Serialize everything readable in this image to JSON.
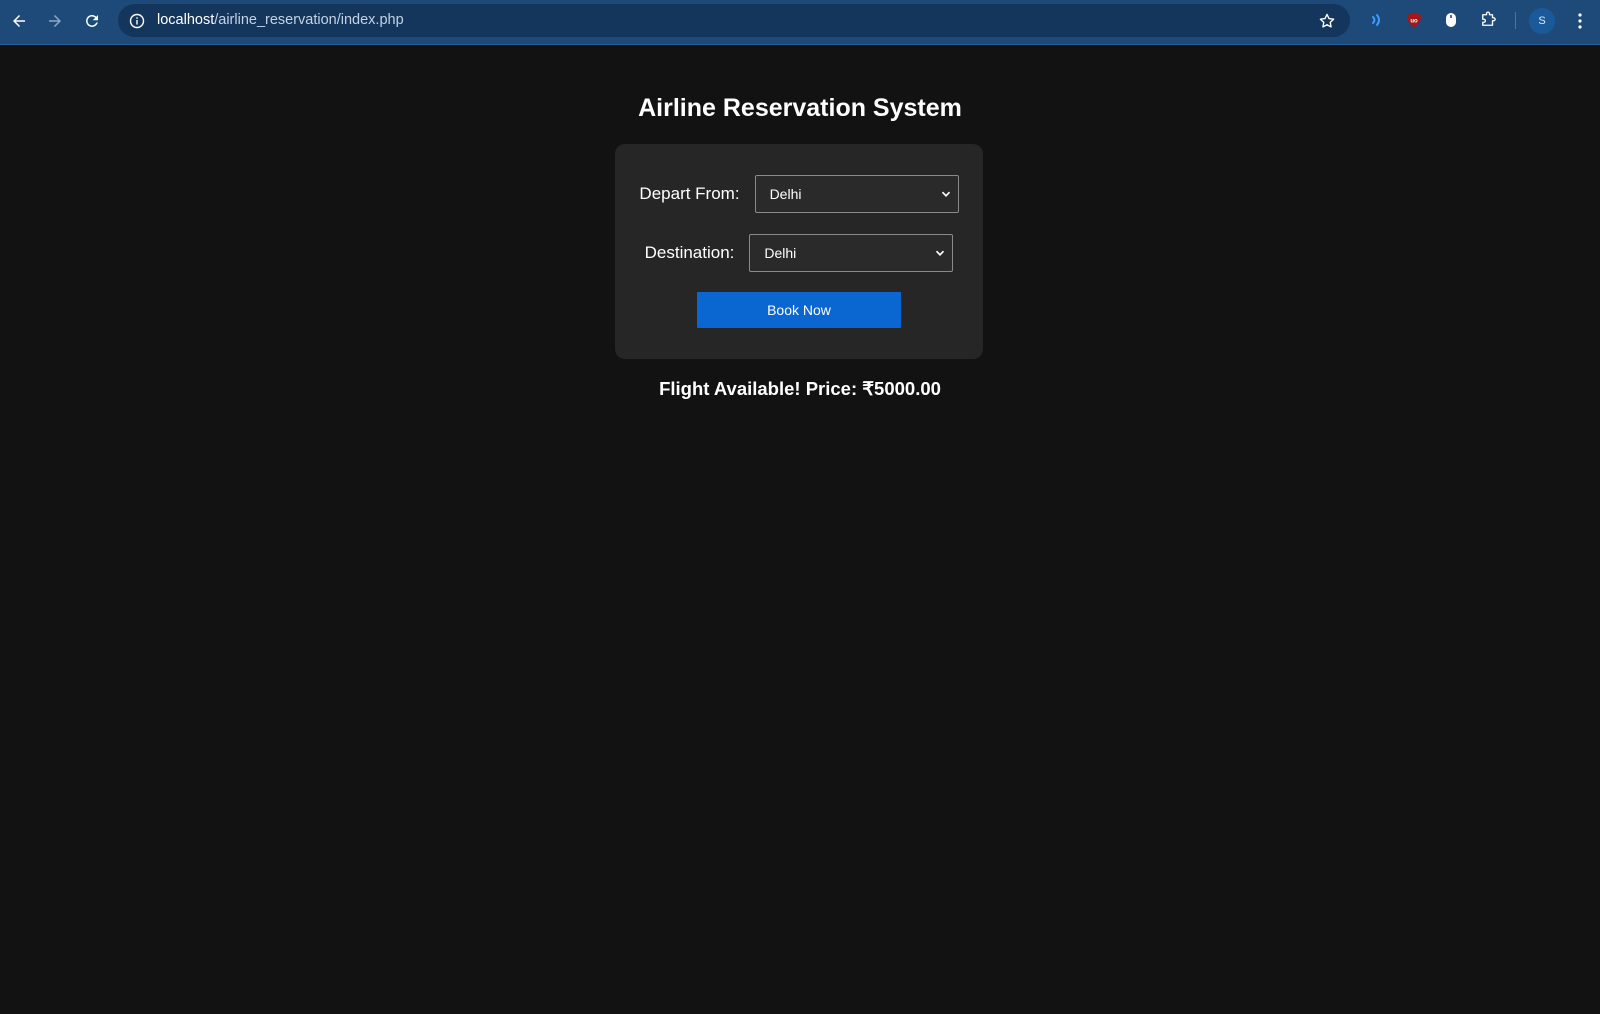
{
  "browser": {
    "url_host": "localhost",
    "url_path": "/airline_reservation/index.php",
    "profile_initial": "S",
    "ublock_badge": "uo",
    "colors": {
      "toolbar": "#1d4a78",
      "omnibox": "#15365c"
    }
  },
  "page": {
    "title": "Airline Reservation System"
  },
  "form": {
    "depart_label": "Depart From:",
    "depart_value": "Delhi",
    "destination_label": "Destination:",
    "destination_value": "Delhi",
    "book_button": "Book Now"
  },
  "result": {
    "message": "Flight Available! Price: ₹5000.00"
  },
  "icons": [
    "back-icon",
    "forward-icon",
    "reload-icon",
    "site-info-icon",
    "star-icon",
    "read-aloud-icon",
    "ublock-icon",
    "mouse-icon",
    "extensions-icon",
    "more-menu-icon"
  ],
  "colors": {
    "background": "#121212",
    "card": "#262626",
    "button": "#0a66d0",
    "text": "#ffffff"
  }
}
